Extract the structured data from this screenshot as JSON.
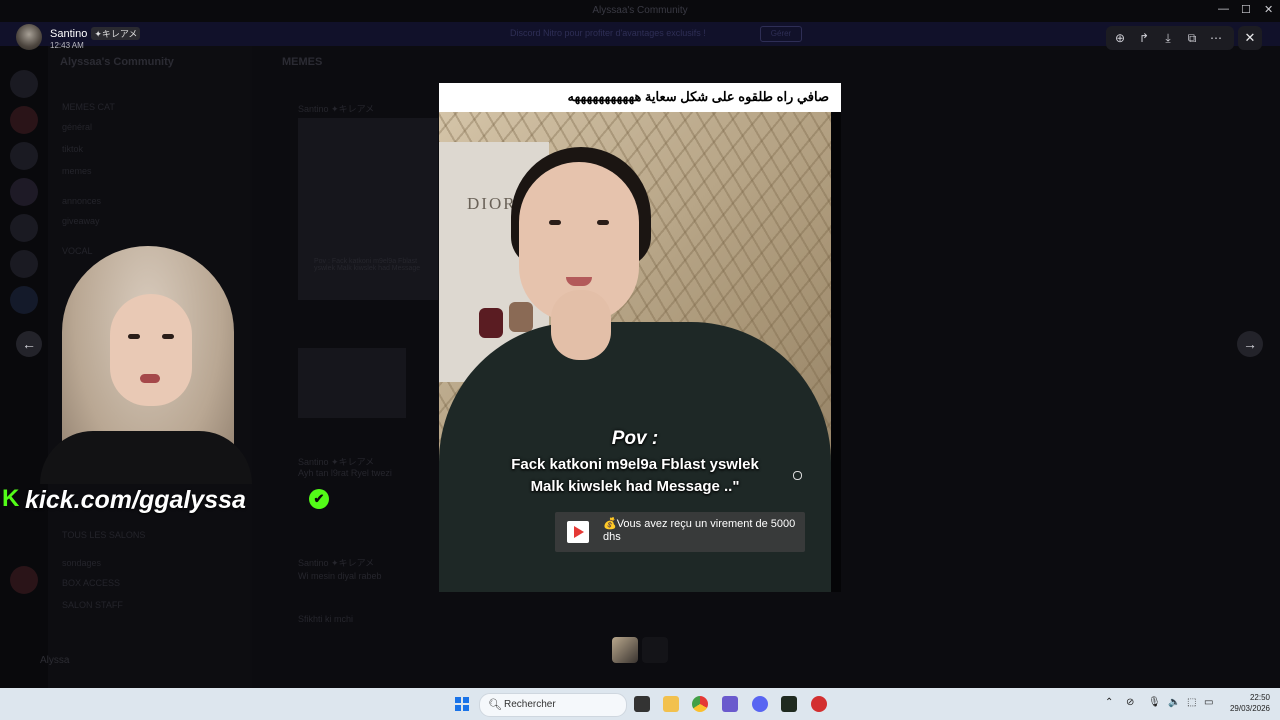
{
  "background_app": {
    "window_title": "Alyssaa's Community",
    "banner_text": "Discord Nitro pour profiter d'avantages exclusifs !",
    "banner_button": "Gérer",
    "server_name": "Alyssaa's Community",
    "channel_title": "MEMES",
    "channels": [
      "MEMES CAT",
      "général",
      "tiktok",
      "memes",
      "annonces",
      "giveaway",
      "VOCAL",
      "TOUS LES SALONS",
      "sondages",
      "BOX ACCESS",
      "SALON STAFF"
    ],
    "messages": [
      "Santino ✦キレアメ",
      "Pov : Fack katkoni m9el9a Fblast yswlek Malk kiwslek had Message",
      "Santino ✦キレアメ",
      "Ayh tan l9rat Ryel twezi",
      "Santino ✦キレアメ",
      "Wi mesin diyal rabeb",
      "Sfikhti ki mchi"
    ],
    "user_name": "Alyssa"
  },
  "viewer": {
    "user": {
      "name": "Santino",
      "tag": "✦キレアメ",
      "time": "12:43 AM"
    },
    "toolbar": [
      {
        "name": "zoom-icon",
        "glyph": "⊕"
      },
      {
        "name": "forward-icon",
        "glyph": "↱"
      },
      {
        "name": "download-icon",
        "glyph": "⤓"
      },
      {
        "name": "open-external-icon",
        "glyph": "⧉"
      },
      {
        "name": "more-icon",
        "glyph": "⋯"
      }
    ],
    "close_glyph": "✕",
    "prev_glyph": "←",
    "next_glyph": "→",
    "media": {
      "caption": "صافي راه طلقوه على شكل سعاية هههههههههههه",
      "brand_text": "DIOR",
      "pov": "Pov :",
      "line1": "Fack katkoni m9el9a Fblast yswlek",
      "line2": "Malk kiwslek had Message ..\"",
      "notification": "💰Vous avez reçu un virement de 5000 dhs"
    }
  },
  "streamer_overlay": {
    "kick_logo": "K",
    "kick_text": "kick.com/ggalyssa",
    "verified_glyph": "✔"
  },
  "taskbar": {
    "search_placeholder": "Rechercher",
    "tray_glyphs": [
      "⌃",
      "⊘",
      "🎙",
      "🔈",
      "⬚",
      "▭"
    ],
    "time": "22:50",
    "date": "29/03/2026",
    "apps": [
      {
        "name": "file-explorer-icon",
        "color": "#f2c14e"
      },
      {
        "name": "chrome-icon",
        "color": "#e53935"
      },
      {
        "name": "snipping-tool-icon",
        "color": "#6a5acd"
      },
      {
        "name": "discord-icon",
        "color": "#5865f2"
      },
      {
        "name": "terminal-icon",
        "color": "#1f2a1f"
      },
      {
        "name": "app-icon",
        "color": "#d32f2f"
      }
    ]
  }
}
